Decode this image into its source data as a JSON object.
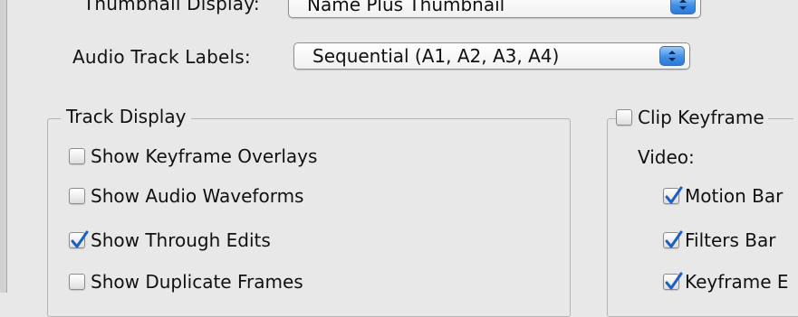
{
  "general": {
    "thumbnail_display": {
      "label": "Thumbnail Display:",
      "value": "Name Plus Thumbnail"
    },
    "audio_track_labels": {
      "label": "Audio Track Labels:",
      "value": "Sequential (A1, A2, A3, A4)"
    }
  },
  "track_display": {
    "title": "Track Display",
    "options": [
      {
        "label": "Show Keyframe Overlays",
        "checked": false
      },
      {
        "label": "Show Audio Waveforms",
        "checked": false
      },
      {
        "label": "Show Through Edits",
        "checked": true
      },
      {
        "label": "Show Duplicate Frames",
        "checked": false
      }
    ]
  },
  "clip_keyframes": {
    "title": "Clip Keyframe",
    "checked": false,
    "video_label": "Video:",
    "options": [
      {
        "label": "Motion Bar",
        "checked": true
      },
      {
        "label": "Filters Bar",
        "checked": true
      },
      {
        "label": "Keyframe E",
        "checked": true
      }
    ]
  },
  "colors": {
    "accent": "#2d7ad9",
    "check": "#1f5fc4",
    "panel": "#e8e8e8"
  }
}
